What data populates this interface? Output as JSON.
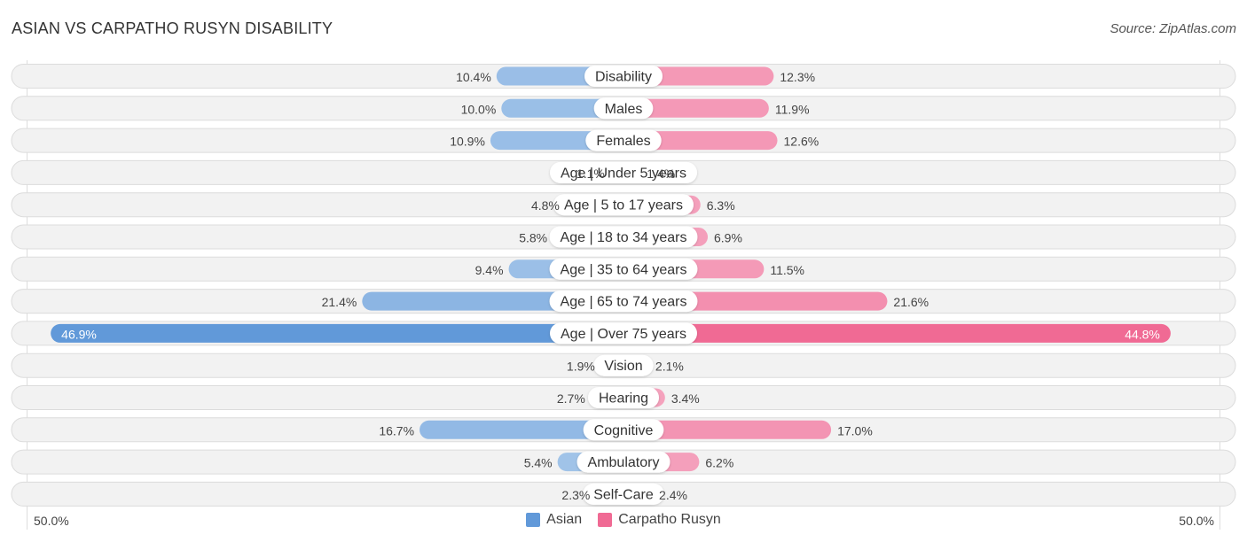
{
  "header": {
    "title": "ASIAN VS CARPATHO RUSYN DISABILITY",
    "source": "Source: ZipAtlas.com"
  },
  "colors": {
    "asian_light": "#a7c7ea",
    "asian_strong": "#6199d9",
    "rusyn_light": "#f5a6c0",
    "rusyn_strong": "#f06a94"
  },
  "chart_data": {
    "type": "bar",
    "orientation": "horizontal-diverging",
    "title": "ASIAN VS CARPATHO RUSYN DISABILITY",
    "categories": [
      "Disability",
      "Males",
      "Females",
      "Age | Under 5 years",
      "Age | 5 to 17 years",
      "Age | 18 to 34 years",
      "Age | 35 to 64 years",
      "Age | 65 to 74 years",
      "Age | Over 75 years",
      "Vision",
      "Hearing",
      "Cognitive",
      "Ambulatory",
      "Self-Care"
    ],
    "series": [
      {
        "name": "Asian",
        "side": "left",
        "values": [
          10.4,
          10.0,
          10.9,
          1.1,
          4.8,
          5.8,
          9.4,
          21.4,
          46.9,
          1.9,
          2.7,
          16.7,
          5.4,
          2.3
        ],
        "labels": [
          "10.4%",
          "10.0%",
          "10.9%",
          "1.1%",
          "4.8%",
          "5.8%",
          "9.4%",
          "21.4%",
          "46.9%",
          "1.9%",
          "2.7%",
          "16.7%",
          "5.4%",
          "2.3%"
        ]
      },
      {
        "name": "Carpatho Rusyn",
        "side": "right",
        "values": [
          12.3,
          11.9,
          12.6,
          1.4,
          6.3,
          6.9,
          11.5,
          21.6,
          44.8,
          2.1,
          3.4,
          17.0,
          6.2,
          2.4
        ],
        "labels": [
          "12.3%",
          "11.9%",
          "12.6%",
          "1.4%",
          "6.3%",
          "6.9%",
          "11.5%",
          "21.6%",
          "44.8%",
          "2.1%",
          "3.4%",
          "17.0%",
          "6.2%",
          "2.4%"
        ]
      }
    ],
    "xlim": [
      -50,
      50
    ],
    "axis_labels": {
      "left": "50.0%",
      "right": "50.0%"
    },
    "legend": {
      "position": "bottom-center",
      "entries": [
        "Asian",
        "Carpatho Rusyn"
      ]
    },
    "highlighted_category": "Age | Over 75 years"
  }
}
